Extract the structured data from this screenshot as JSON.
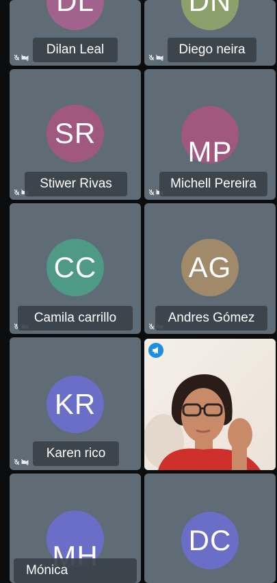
{
  "participants": [
    {
      "initials": "DL",
      "name": "Dilan Leal",
      "color": "#a1628b"
    },
    {
      "initials": "DN",
      "name": "Diego neira",
      "color": "#8ca06b"
    },
    {
      "initials": "SR",
      "name": "Stiwer Rivas",
      "color": "#a1587f"
    },
    {
      "initials": "MP",
      "name": "Michell Pereira",
      "color": "#a1587f"
    },
    {
      "initials": "CC",
      "name": "Camila carrillo",
      "color": "#4e9a86"
    },
    {
      "initials": "AG",
      "name": "Andres Gómez",
      "color": "#a08a69"
    },
    {
      "initials": "KR",
      "name": "Karen rico",
      "color": "#6b6ec6"
    },
    {
      "initials": "MH",
      "name": "Mónica",
      "color": "#6b6ec6"
    },
    {
      "initials": "DC",
      "name": "",
      "color": "#6b6ec6"
    }
  ],
  "icons": {
    "mute": "mic-off-camera-off-icon",
    "speaker": "megaphone-icon"
  }
}
